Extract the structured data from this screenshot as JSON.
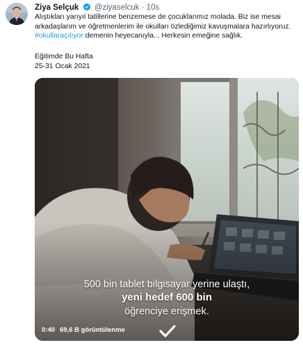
{
  "author": {
    "name": "Ziya Selçuk",
    "handle": "@ziyaselcuk",
    "separator": "·",
    "time": "10s"
  },
  "tweet": {
    "text_part1": "Alıştıkları yarıyıl tatillerine benzemese de çocuklarımız molada. Biz ise mesai arkadaşlarım ve öğretmenlerim ile okulları özlediğimiz kavuşmalara hazırlıyoruz. ",
    "hashtag": "#okullaraçılıyor",
    "text_part2": " demenin heyecanıyla... Herkesin emeğine sağlık.",
    "line1": "Eğitimde Bu Hafta",
    "line2": "25-31 Ocak 2021"
  },
  "video": {
    "caption_line1": "500 bin tablet bilgisayar yerine ulaştı,",
    "caption_line2": "yeni hedef 600 bin",
    "caption_line3": "öğrenciye erişmek.",
    "elapsed": "0:40",
    "views": "69,6 B görüntülenme"
  },
  "colors": {
    "link": "#1d9bf0",
    "verified": "#1d9bf0",
    "muted": "#536471"
  },
  "icons": [
    "verified-badge-icon",
    "checkmark-icon"
  ]
}
